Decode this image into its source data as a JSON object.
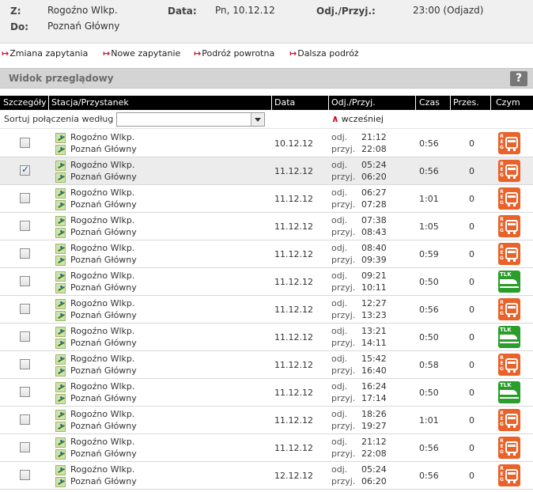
{
  "summary": {
    "from_label": "Z:",
    "from_value": "Rogoźno Wlkp.",
    "to_label": "Do:",
    "to_value": "Poznań Główny",
    "date_label": "Data:",
    "date_value": "Pn, 10.12.12",
    "dep_label": "Odj./Przyj.:",
    "dep_value": "23:00 (Odjazd)"
  },
  "links": {
    "change": "Zmiana zapytania",
    "new": "Nowe zapytanie",
    "return": "Podróż powrotna",
    "further": "Dalsza podróż"
  },
  "overview": {
    "title": "Widok przeglądowy",
    "help": "?"
  },
  "table": {
    "headers": {
      "details": "Szczegóły",
      "station": "Stacja/Przystanek",
      "date": "Data",
      "depart_arrive": "Odj./Przyj.",
      "duration": "Czas",
      "changes": "Przes.",
      "products": "Czym"
    },
    "sort_label": "Sortuj połączenia według",
    "sort_value": "",
    "earlier": "wcześniej",
    "dep_word": "odj.",
    "arr_word": "przyj."
  },
  "rows": [
    {
      "from": "Rogoźno Wlkp.",
      "to": "Poznań Główny",
      "date": "10.12.12",
      "dep": "21:12",
      "arr": "22:08",
      "duration": "0:56",
      "changes": "0",
      "product": "reg",
      "checked": false
    },
    {
      "from": "Rogoźno Wlkp.",
      "to": "Poznań Główny",
      "date": "11.12.12",
      "dep": "05:24",
      "arr": "06:20",
      "duration": "0:56",
      "changes": "0",
      "product": "reg",
      "checked": true
    },
    {
      "from": "Rogoźno Wlkp.",
      "to": "Poznań Główny",
      "date": "11.12.12",
      "dep": "06:27",
      "arr": "07:28",
      "duration": "1:01",
      "changes": "0",
      "product": "reg",
      "checked": false
    },
    {
      "from": "Rogoźno Wlkp.",
      "to": "Poznań Główny",
      "date": "11.12.12",
      "dep": "07:38",
      "arr": "08:43",
      "duration": "1:05",
      "changes": "0",
      "product": "reg",
      "checked": false
    },
    {
      "from": "Rogoźno Wlkp.",
      "to": "Poznań Główny",
      "date": "11.12.12",
      "dep": "08:40",
      "arr": "09:39",
      "duration": "0:59",
      "changes": "0",
      "product": "reg",
      "checked": false
    },
    {
      "from": "Rogoźno Wlkp.",
      "to": "Poznań Główny",
      "date": "11.12.12",
      "dep": "09:21",
      "arr": "10:11",
      "duration": "0:50",
      "changes": "0",
      "product": "tlk",
      "checked": false
    },
    {
      "from": "Rogoźno Wlkp.",
      "to": "Poznań Główny",
      "date": "11.12.12",
      "dep": "12:27",
      "arr": "13:23",
      "duration": "0:56",
      "changes": "0",
      "product": "reg",
      "checked": false
    },
    {
      "from": "Rogoźno Wlkp.",
      "to": "Poznań Główny",
      "date": "11.12.12",
      "dep": "13:21",
      "arr": "14:11",
      "duration": "0:50",
      "changes": "0",
      "product": "tlk",
      "checked": false
    },
    {
      "from": "Rogoźno Wlkp.",
      "to": "Poznań Główny",
      "date": "11.12.12",
      "dep": "15:42",
      "arr": "16:40",
      "duration": "0:58",
      "changes": "0",
      "product": "reg",
      "checked": false
    },
    {
      "from": "Rogoźno Wlkp.",
      "to": "Poznań Główny",
      "date": "11.12.12",
      "dep": "16:24",
      "arr": "17:14",
      "duration": "0:50",
      "changes": "0",
      "product": "tlk",
      "checked": false
    },
    {
      "from": "Rogoźno Wlkp.",
      "to": "Poznań Główny",
      "date": "11.12.12",
      "dep": "18:26",
      "arr": "19:27",
      "duration": "1:01",
      "changes": "0",
      "product": "reg",
      "checked": false
    },
    {
      "from": "Rogoźno Wlkp.",
      "to": "Poznań Główny",
      "date": "11.12.12",
      "dep": "21:12",
      "arr": "22:08",
      "duration": "0:56",
      "changes": "0",
      "product": "reg",
      "checked": false
    },
    {
      "from": "Rogoźno Wlkp.",
      "to": "Poznań Główny",
      "date": "12.12.12",
      "dep": "05:24",
      "arr": "06:20",
      "duration": "0:56",
      "changes": "0",
      "product": "reg",
      "checked": false
    }
  ],
  "products": {
    "reg_label": "REG",
    "tlk_label": "TLK"
  },
  "colors": {
    "accent": "#c8102e",
    "reg": "#e8622a",
    "tlk": "#2a9d2a"
  }
}
